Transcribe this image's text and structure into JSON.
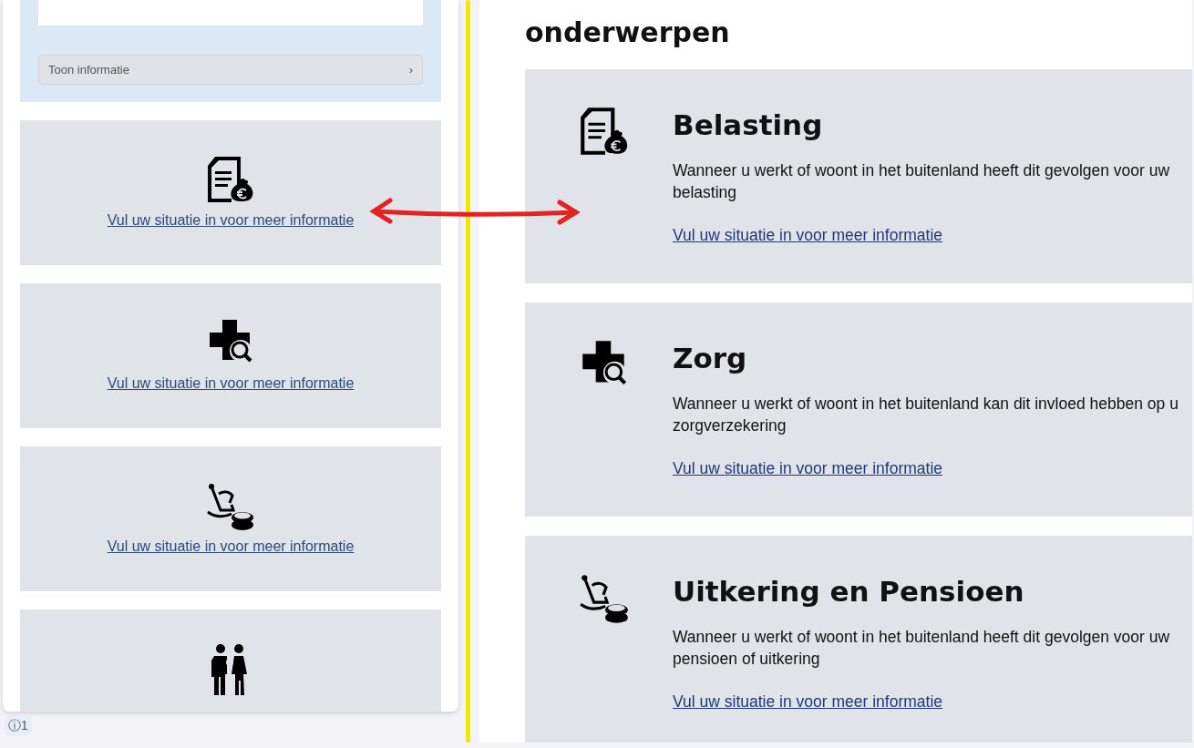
{
  "left_panel": {
    "toon_button": {
      "label": "Toon informatie",
      "chevron": "›"
    },
    "cards": [
      {
        "kind": "tax",
        "link": "Vul uw situatie in voor meer informatie"
      },
      {
        "kind": "care",
        "link": "Vul uw situatie in voor meer informatie"
      },
      {
        "kind": "pension",
        "link": "Vul uw situatie in voor meer informatie"
      },
      {
        "kind": "family"
      }
    ]
  },
  "info_badge": {
    "icon": "ⓘ",
    "count": "1"
  },
  "right_panel": {
    "heading": "onderwerpen",
    "cards": [
      {
        "kind": "tax",
        "title": "Belasting",
        "description": "Wanneer u werkt of woont in het buitenland heeft dit gevolgen voor uw belasting",
        "link": "Vul uw situatie in voor meer informatie"
      },
      {
        "kind": "care",
        "title": "Zorg",
        "description": "Wanneer u werkt of woont in het buitenland kan dit invloed hebben op u zorgverzekering",
        "link": "Vul uw situatie in voor meer informatie"
      },
      {
        "kind": "pension",
        "title": "Uitkering en Pensioen",
        "description": "Wanneer u werkt of woont in het buitenland heeft dit gevolgen voor uw pensioen of uitkering",
        "link": "Vul uw situatie in voor meer informatie"
      }
    ]
  }
}
